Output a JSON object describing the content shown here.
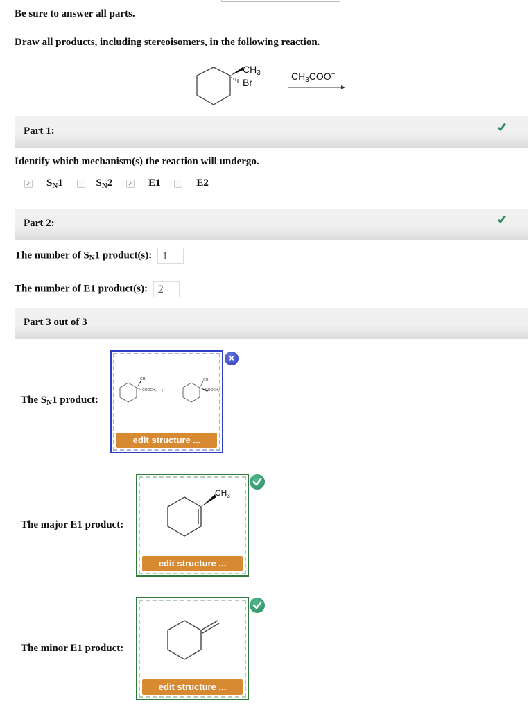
{
  "instructions": {
    "answer_all": "Be sure to answer all parts.",
    "prompt": "Draw all products, including stereoisomers, in the following reaction."
  },
  "reaction": {
    "substituent_top": "CH3",
    "substituent_bottom": "Br",
    "reagent": "CH3COO−"
  },
  "part1": {
    "title": "Part 1:",
    "status": "correct",
    "question": "Identify which mechanism(s) the reaction will undergo.",
    "options": [
      {
        "main": "S",
        "sub": "N",
        "suffix": "1",
        "checked": true
      },
      {
        "main": "S",
        "sub": "N",
        "suffix": "2",
        "checked": false
      },
      {
        "main": "E1",
        "sub": "",
        "suffix": "",
        "checked": true
      },
      {
        "main": "E2",
        "sub": "",
        "suffix": "",
        "checked": false
      }
    ]
  },
  "part2": {
    "title": "Part 2:",
    "status": "correct",
    "sn1_count_label_pre": "The number of S",
    "sn1_count_label_sub": "N",
    "sn1_count_label_post": "1 product(s):",
    "sn1_count_value": "1",
    "e1_count_label": "The number of E1 product(s):",
    "e1_count_value": "2"
  },
  "part3": {
    "title": "Part 3 out of 3",
    "sn1_label_pre": "The S",
    "sn1_label_sub": "N",
    "sn1_label_post": "1 product:",
    "sn1_structure": {
      "group_top": "CH3",
      "group_side": "COOCH3",
      "plus": "+",
      "close_label": "×"
    },
    "major_label": "The major E1 product:",
    "major_structure": {
      "group": "CH3"
    },
    "minor_label": "The minor E1 product:",
    "edit_button_label": "edit structure ..."
  },
  "colors": {
    "check_green": "#2e8a5a",
    "edit_orange": "#d88a33",
    "blue_border": "#2c3ec4",
    "green_border": "#2d7a3a"
  }
}
